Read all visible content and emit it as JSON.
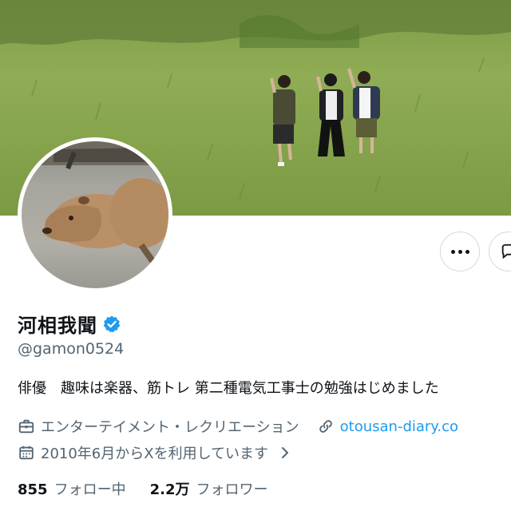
{
  "profile": {
    "display_name": "河相我聞",
    "handle": "@gamon0524",
    "bio": "俳優　趣味は楽器、筋トレ 第二種電気工事士の勉強はじめました",
    "category": "エンターテイメント・レクリエーション",
    "website": "otousan-diary.co",
    "joined": "2010年6月からXを利用しています",
    "verified_color": "#1d9bf0"
  },
  "stats": {
    "following_count": "855",
    "following_label": "フォロー中",
    "followers_count": "2.2万",
    "followers_label": "フォロワー"
  },
  "icons": {
    "more": "more-dots-icon",
    "message": "message-icon",
    "verified": "verified-badge-icon",
    "category": "briefcase-icon",
    "link": "link-icon",
    "calendar": "calendar-icon",
    "chevron": "chevron-right-icon"
  }
}
